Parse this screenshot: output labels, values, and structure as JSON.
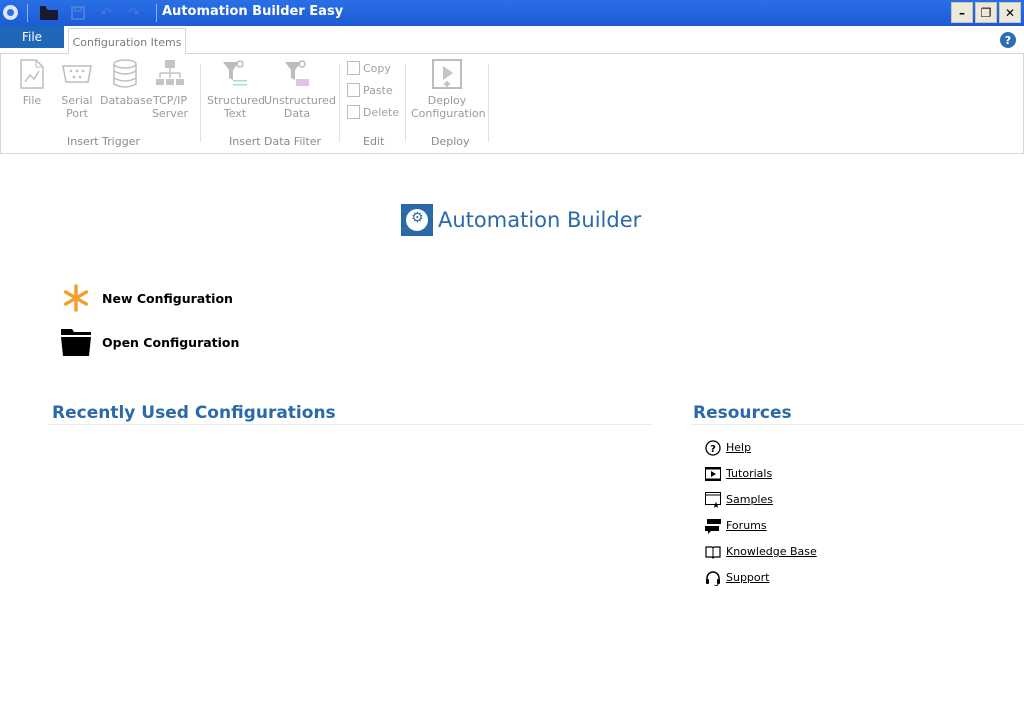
{
  "window": {
    "title": "Automation Builder Easy",
    "controls": {
      "minimize": "–",
      "restore": "❐",
      "close": "✕"
    }
  },
  "quick_access": {
    "icons": [
      "app-icon",
      "open-folder-icon",
      "save-icon",
      "undo-icon",
      "redo-icon"
    ]
  },
  "tabs": {
    "file": "File",
    "configuration_items": "Configuration Items",
    "help": "?"
  },
  "ribbon": {
    "groups": [
      {
        "label": "Insert Trigger",
        "buttons": [
          {
            "line1": "File",
            "line2": "",
            "icon": "file-chart-icon"
          },
          {
            "line1": "Serial",
            "line2": "Port",
            "icon": "serial-port-icon"
          },
          {
            "line1": "Database",
            "line2": "",
            "icon": "database-icon"
          },
          {
            "line1": "TCP/IP",
            "line2": "Server",
            "icon": "network-server-icon"
          }
        ]
      },
      {
        "label": "Insert Data Filter",
        "buttons": [
          {
            "line1": "Structured",
            "line2": "Text",
            "icon": "filter-text-icon"
          },
          {
            "line1": "Unstructured",
            "line2": "Data",
            "icon": "filter-data-icon"
          }
        ]
      },
      {
        "label": "Edit",
        "buttons": [
          {
            "line1": "Copy",
            "icon": "copy-icon"
          },
          {
            "line1": "Paste",
            "icon": "paste-icon"
          },
          {
            "line1": "Delete",
            "icon": "delete-icon"
          }
        ]
      },
      {
        "label": "Deploy",
        "buttons": [
          {
            "line1": "Deploy",
            "line2": "Configuration",
            "icon": "deploy-icon"
          }
        ]
      }
    ]
  },
  "main": {
    "brand": "Automation Builder",
    "actions": [
      {
        "label": "New Configuration",
        "icon": "asterisk-icon",
        "color": "#f0a030"
      },
      {
        "label": "Open Configuration",
        "icon": "folder-icon",
        "color": "#000000"
      }
    ],
    "recent": {
      "title": "Recently Used Configurations",
      "items": []
    },
    "resources": {
      "title": "Resources",
      "items": [
        {
          "label": "Help",
          "icon": "help-circle-icon"
        },
        {
          "label": "Tutorials",
          "icon": "video-icon"
        },
        {
          "label": "Samples",
          "icon": "samples-icon"
        },
        {
          "label": "Forums",
          "icon": "forums-icon"
        },
        {
          "label": "Knowledge Base",
          "icon": "book-icon"
        },
        {
          "label": "Support",
          "icon": "headset-icon"
        }
      ]
    }
  },
  "colors": {
    "titlebar": "#2a6fe6",
    "file_tab": "#1e66b8",
    "accent": "#2a6aa8",
    "disabled_text": "#9a9a9a"
  }
}
